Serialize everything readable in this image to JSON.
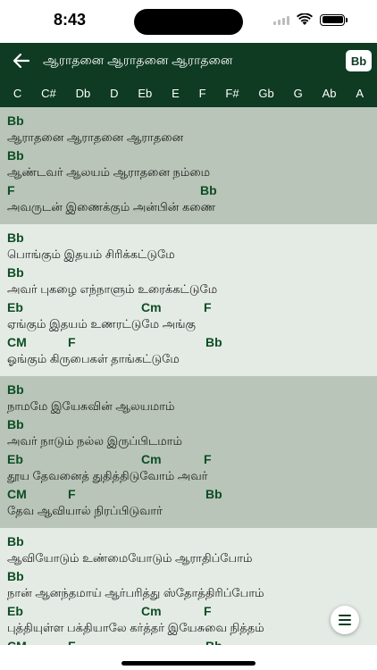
{
  "status_bar": {
    "time": "8:43"
  },
  "app_bar": {
    "title": "ஆராதனை ஆராதனை ஆராதனை",
    "current_key": "Bb"
  },
  "keys": [
    "C",
    "C#",
    "Db",
    "D",
    "Eb",
    "E",
    "F",
    "F#",
    "Gb",
    "G",
    "Ab",
    "A"
  ],
  "sections": [
    {
      "shade": "dark",
      "lines": [
        {
          "chords": [
            "Bb"
          ],
          "lyric": "ஆராதனை ஆராதனை ஆராதனை"
        },
        {
          "chords": [
            "Bb"
          ],
          "lyric": "ஆண்டவர் ஆலயம் ஆராதனை நம்மை"
        },
        {
          "chords": [
            "F",
            "Bb"
          ],
          "lyric": "அவருடன் இணைக்கும் அன்பின் கணை"
        }
      ]
    },
    {
      "shade": "light",
      "lines": [
        {
          "chords": [
            "Bb"
          ],
          "lyric": "பொங்கும் இதயம் சிரிக்கட்டுமே"
        },
        {
          "chords": [
            "Bb"
          ],
          "lyric": "அவர் புகழை எந்நாளும் உரைக்கட்டுமே"
        },
        {
          "chords": [
            "Eb",
            "Cm",
            "F"
          ],
          "lyric": "ஏங்கும் இதயம் உணரட்டுமே அங்கு"
        },
        {
          "chords": [
            "CM",
            "F",
            "Bb"
          ],
          "lyric": "ஓங்கும் கிருபைகள் தாங்கட்டுமே"
        }
      ]
    },
    {
      "shade": "dark",
      "lines": [
        {
          "chords": [
            "Bb"
          ],
          "lyric": "நாமமே இயேசுவின் ஆலயமாம்"
        },
        {
          "chords": [
            "Bb"
          ],
          "lyric": "அவர் நாடும் நல்ல இருப்பிடமாம்"
        },
        {
          "chords": [
            "Eb",
            "Cm",
            "F"
          ],
          "lyric": "தூய தேவனைத் துதித்திடுவோம் அவர்"
        },
        {
          "chords": [
            "CM",
            "F",
            "Bb"
          ],
          "lyric": "தேவ ஆவியால் நிரப்பிடுவார்"
        }
      ]
    },
    {
      "shade": "light",
      "lines": [
        {
          "chords": [
            "Bb"
          ],
          "lyric": "ஆவியோடும் உண்மையோடும் ஆராதிப்போம்"
        },
        {
          "chords": [
            "Bb"
          ],
          "lyric": "நான் ஆனந்தமாய் ஆர்பரித்து ஸ்தோத்திரிப்போம்"
        },
        {
          "chords": [
            "Eb",
            "Cm",
            "F"
          ],
          "lyric": "புத்தியுள்ள பக்தியாலே கர்த்தர் இயேசுவை நித்தம்"
        },
        {
          "chords": [
            "CM",
            "F",
            "Bb"
          ],
          "lyric": ""
        }
      ]
    }
  ],
  "icons": {
    "back": "arrow-left-icon",
    "fab": "menu-lines-icon",
    "wifi": "wifi-icon",
    "battery": "battery-icon",
    "signal": "signal-icon"
  },
  "colors": {
    "header_bg": "#0e3b22",
    "chord_text": "#0c4d24",
    "section_dark": "#b8c5b8",
    "section_light": "#e4ebe4"
  }
}
